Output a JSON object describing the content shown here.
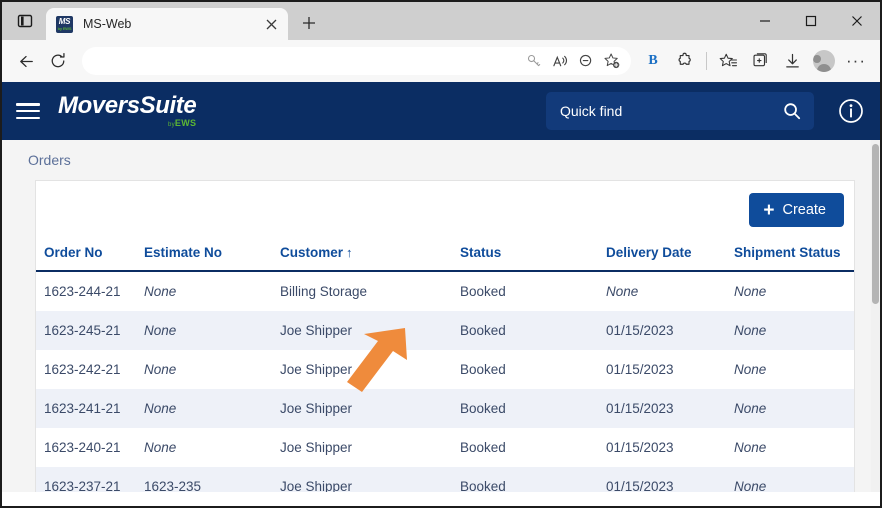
{
  "browser": {
    "tab": {
      "title": "MS-Web",
      "favicon_text": "MS",
      "favicon_sub": "by EWS",
      "close_label": "×"
    },
    "newtab_label": "+",
    "tab_list_icon": "tab-list-icon",
    "window": {
      "minimize": "—",
      "maximize": "▢",
      "close": "✕"
    },
    "nav": {
      "back": "back-arrow-icon",
      "reload": "reload-icon"
    },
    "address": {
      "value": "",
      "placeholder": ""
    },
    "omni_icons": [
      "key-icon",
      "read-aloud-icon",
      "zoom-out-icon",
      "add-favorite-icon"
    ],
    "toolbar_icons": [
      "bing-icon",
      "extensions-icon",
      "favorites-icon",
      "collections-icon",
      "downloads-icon",
      "profile-icon",
      "more-icon"
    ],
    "bing_label": "B",
    "more_label": "···"
  },
  "appbar": {
    "menu_icon": "hamburger-menu-icon",
    "logo_primary": "Movers",
    "logo_secondary": "Suite",
    "logo_by": "by",
    "logo_brand": "EWS",
    "quick_find": {
      "value": "",
      "placeholder": "Quick find",
      "icon": "search-icon"
    },
    "info_icon": "info-icon"
  },
  "page": {
    "breadcrumb": "Orders",
    "create_button": {
      "label": "Create",
      "plus": "+"
    },
    "sort_indicator": "↑"
  },
  "table": {
    "columns": [
      {
        "key": "order_no",
        "label": "Order No"
      },
      {
        "key": "estimate_no",
        "label": "Estimate No"
      },
      {
        "key": "customer",
        "label": "Customer"
      },
      {
        "key": "status",
        "label": "Status"
      },
      {
        "key": "delivery_date",
        "label": "Delivery Date"
      },
      {
        "key": "shipment_status",
        "label": "Shipment Status"
      }
    ],
    "sorted_column": "customer",
    "sort_direction": "asc",
    "rows": [
      {
        "order_no": "1623-244-21",
        "estimate_no": "None",
        "estimate_none": true,
        "customer": "Billing Storage",
        "status": "Booked",
        "delivery_date": "None",
        "delivery_none": true,
        "shipment_status": "None",
        "shipment_none": true
      },
      {
        "order_no": "1623-245-21",
        "estimate_no": "None",
        "estimate_none": true,
        "customer": "Joe Shipper",
        "status": "Booked",
        "delivery_date": "01/15/2023",
        "delivery_none": false,
        "shipment_status": "None",
        "shipment_none": true
      },
      {
        "order_no": "1623-242-21",
        "estimate_no": "None",
        "estimate_none": true,
        "customer": "Joe Shipper",
        "status": "Booked",
        "delivery_date": "01/15/2023",
        "delivery_none": false,
        "shipment_status": "None",
        "shipment_none": true
      },
      {
        "order_no": "1623-241-21",
        "estimate_no": "None",
        "estimate_none": true,
        "customer": "Joe Shipper",
        "status": "Booked",
        "delivery_date": "01/15/2023",
        "delivery_none": false,
        "shipment_status": "None",
        "shipment_none": true
      },
      {
        "order_no": "1623-240-21",
        "estimate_no": "None",
        "estimate_none": true,
        "customer": "Joe Shipper",
        "status": "Booked",
        "delivery_date": "01/15/2023",
        "delivery_none": false,
        "shipment_status": "None",
        "shipment_none": true
      },
      {
        "order_no": "1623-237-21",
        "estimate_no": "1623-235",
        "estimate_none": false,
        "customer": "Joe Shipper",
        "status": "Booked",
        "delivery_date": "01/15/2023",
        "delivery_none": false,
        "shipment_status": "None",
        "shipment_none": true
      }
    ]
  },
  "annotation": {
    "arrow": "orange-arrow-annotation",
    "color": "#ef8b3c",
    "points_at": "customer-column-sort"
  },
  "colors": {
    "app_header": "#0b2d63",
    "accent_blue": "#0f4c9b",
    "link_blue": "#2b5ca8",
    "row_stripe": "#eef1f8",
    "brand_green": "#5cb633",
    "annotation_orange": "#ef8b3c"
  }
}
